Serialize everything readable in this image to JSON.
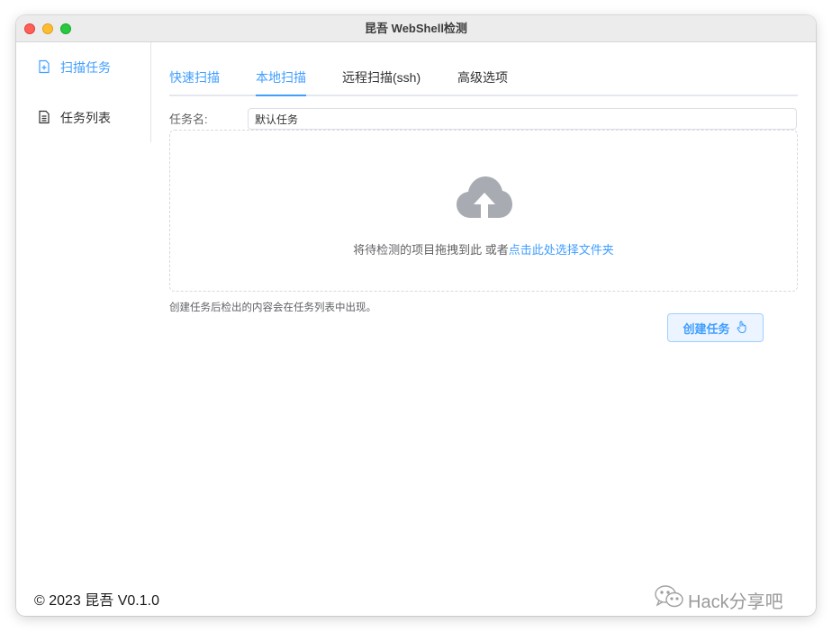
{
  "window": {
    "title": "昆吾 WebShell检测"
  },
  "sidebar": {
    "items": [
      {
        "label": "扫描任务",
        "icon": "document-add-icon",
        "active": true
      },
      {
        "label": "任务列表",
        "icon": "document-icon",
        "active": false
      }
    ]
  },
  "tabs": [
    {
      "label": "快速扫描"
    },
    {
      "label": "本地扫描",
      "active": true
    },
    {
      "label": "远程扫描(ssh)"
    },
    {
      "label": "高级选项"
    }
  ],
  "form": {
    "task_name_label": "任务名:",
    "task_name_value": "默认任务"
  },
  "upload": {
    "icon": "upload-cloud-icon",
    "text": "将待检测的项目拖拽到此 或者",
    "link": "点击此处选择文件夹"
  },
  "hint": "创建任务后检出的内容会在任务列表中出现。",
  "create_button": {
    "label": "创建任务",
    "icon": "pointer-hand-icon"
  },
  "footer": {
    "copyright": "© 2023 昆吾 V0.1.0"
  },
  "watermark": {
    "text": "Hack分享吧",
    "icon": "wechat-icon"
  },
  "colors": {
    "accent": "#409eff",
    "accent_light_bg": "#ecf5ff",
    "text": "#303133"
  }
}
